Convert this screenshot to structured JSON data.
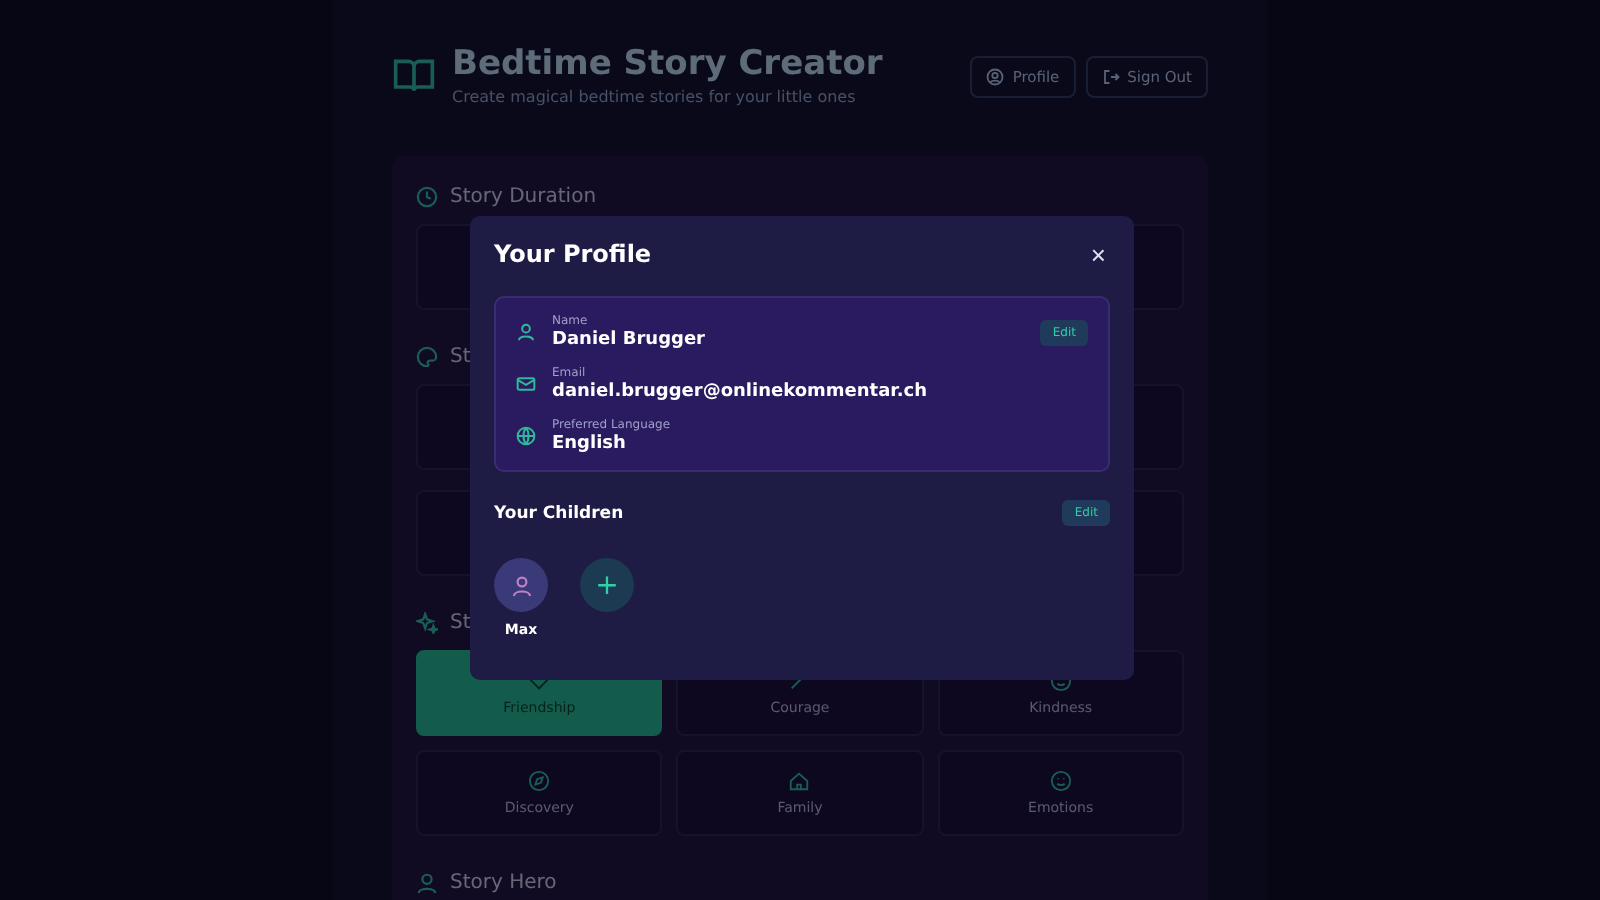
{
  "header": {
    "title": "Bedtime Story Creator",
    "subtitle": "Create magical bedtime stories for your little ones",
    "buttons": [
      {
        "label": "Profile",
        "kind": "profile"
      },
      {
        "label": "Sign Out",
        "kind": "signout"
      }
    ]
  },
  "sections": [
    {
      "title": "Story Duration",
      "kind": "cards"
    },
    {
      "title": "St",
      "kind": "cards"
    },
    {
      "title": "St",
      "kind": "themes",
      "themes": [
        {
          "label": "Friendship",
          "selected": true
        },
        {
          "label": "Courage",
          "selected": false
        },
        {
          "label": "Kindness",
          "selected": false
        },
        {
          "label": "Discovery",
          "selected": false
        },
        {
          "label": "Family",
          "selected": false
        },
        {
          "label": "Emotions",
          "selected": false
        }
      ]
    },
    {
      "title": "Story Hero",
      "kind": "heading"
    }
  ],
  "modal": {
    "title": "Your Profile",
    "close": "×",
    "fields": [
      {
        "label": "Name",
        "value": "Daniel Brugger",
        "edit": "Edit"
      },
      {
        "label": "Email",
        "value": "daniel.brugger@onlinekommentar.ch"
      },
      {
        "label": "Preferred Language",
        "value": "English"
      }
    ],
    "children_title": "Your Children",
    "children_edit": "Edit",
    "children": [
      {
        "name": "Max"
      }
    ],
    "add": "+"
  }
}
